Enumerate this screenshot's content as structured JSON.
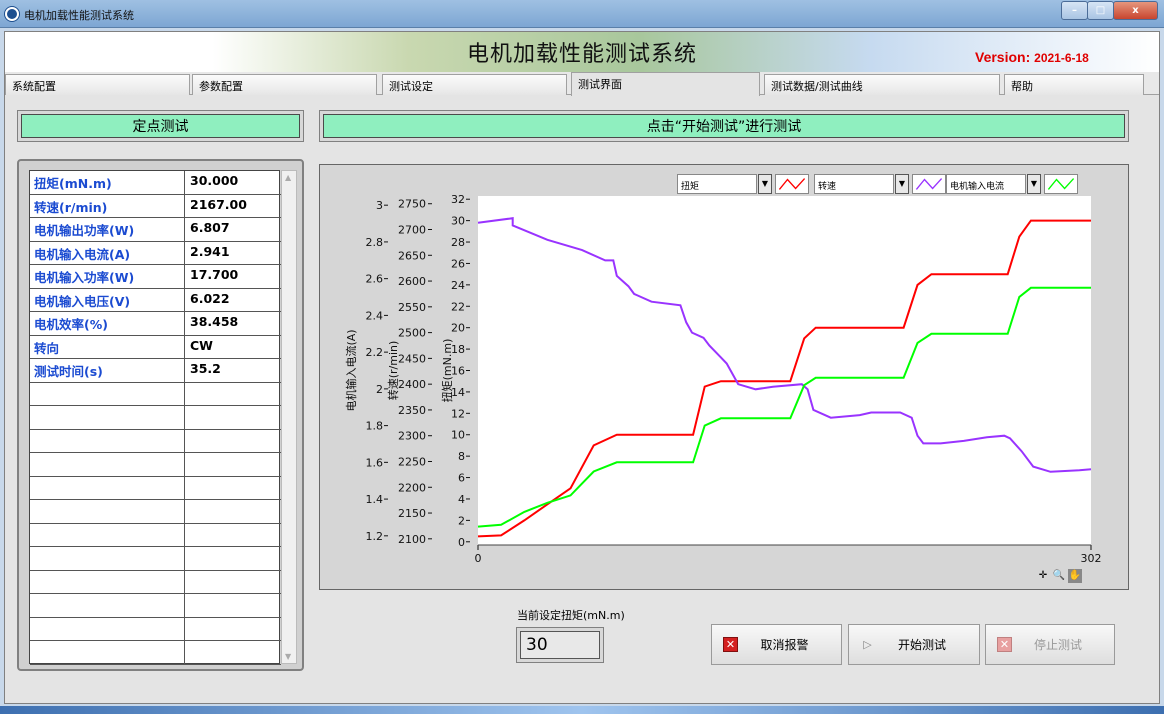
{
  "window": {
    "title": "电机加载性能测试系统",
    "min": "–",
    "max": "□",
    "close": "x"
  },
  "banner": {
    "title": "电机加载性能测试系统",
    "version_prefix": "Version: ",
    "version_date": "2021-6-18"
  },
  "tabs": [
    {
      "label": "系统配置"
    },
    {
      "label": "参数配置"
    },
    {
      "label": "测试设定"
    },
    {
      "label": "测试界面",
      "active": true
    },
    {
      "label": "测试数据/测试曲线"
    },
    {
      "label": "帮助"
    }
  ],
  "left_panel": {
    "title": "定点测试"
  },
  "right_panel": {
    "title": "点击“开始测试”进行测试"
  },
  "table": {
    "rows": [
      {
        "name": "扭矩(mN.m)",
        "value": "30.000"
      },
      {
        "name": "转速(r/min)",
        "value": "2167.00"
      },
      {
        "name": "电机输出功率(W)",
        "value": "6.807"
      },
      {
        "name": "电机输入电流(A)",
        "value": "2.941"
      },
      {
        "name": "电机输入功率(W)",
        "value": "17.700"
      },
      {
        "name": "电机输入电压(V)",
        "value": "6.022"
      },
      {
        "name": "电机效率(%)",
        "value": "38.458"
      },
      {
        "name": "转向",
        "value": "CW"
      },
      {
        "name": "测试时间(s)",
        "value": "35.2"
      }
    ],
    "empty_rows": 12
  },
  "legend": [
    {
      "label": "扭矩",
      "color": "#ff0000"
    },
    {
      "label": "转速",
      "color": "#9933ff"
    },
    {
      "label": "电机输入电流",
      "color": "#00ff00"
    }
  ],
  "chart_data": {
    "type": "line",
    "x_range": [
      0,
      302
    ],
    "x_ticks": [
      "0",
      "302"
    ],
    "axes": [
      {
        "label": "电机输入电流(A)",
        "range": [
          1.15,
          3.05
        ],
        "ticks": [
          "1.2",
          "1.4",
          "1.6",
          "1.8",
          "2",
          "2.2",
          "2.4",
          "2.6",
          "2.8",
          "3"
        ]
      },
      {
        "label": "转速(r/min)",
        "range": [
          2088,
          2765
        ],
        "ticks": [
          "2100",
          "2150",
          "2200",
          "2250",
          "2300",
          "2350",
          "2400",
          "2450",
          "2500",
          "2550",
          "2600",
          "2650",
          "2700",
          "2750"
        ]
      },
      {
        "label": "扭矩(mN.m)",
        "range": [
          -0.3,
          32.3
        ],
        "ticks": [
          "0",
          "2",
          "4",
          "6",
          "8",
          "10",
          "12",
          "14",
          "16",
          "18",
          "20",
          "22",
          "24",
          "26",
          "28",
          "30",
          "32"
        ]
      }
    ],
    "series": [
      {
        "name": "扭矩",
        "axis": 2,
        "color": "#ff0000",
        "points": [
          [
            0,
            0.5
          ],
          [
            20,
            0.6
          ],
          [
            40,
            2
          ],
          [
            60,
            3.5
          ],
          [
            80,
            5
          ],
          [
            100,
            9
          ],
          [
            120,
            10
          ],
          [
            140,
            10
          ],
          [
            186,
            10
          ],
          [
            196,
            14.5
          ],
          [
            210,
            15
          ],
          [
            270,
            15
          ],
          [
            282,
            19
          ],
          [
            292,
            20
          ],
          [
            368,
            20
          ],
          [
            380,
            24
          ],
          [
            392,
            25
          ],
          [
            458,
            25
          ],
          [
            468,
            28.5
          ],
          [
            478,
            30
          ],
          [
            530,
            30
          ]
        ]
      },
      {
        "name": "转速",
        "axis": 1,
        "color": "#9933ff",
        "points": [
          [
            0,
            2713
          ],
          [
            30,
            2722
          ],
          [
            30,
            2708
          ],
          [
            60,
            2680
          ],
          [
            90,
            2660
          ],
          [
            110,
            2640
          ],
          [
            117,
            2640
          ],
          [
            120,
            2610
          ],
          [
            130,
            2590
          ],
          [
            135,
            2575
          ],
          [
            140,
            2570
          ],
          [
            150,
            2560
          ],
          [
            175,
            2553
          ],
          [
            180,
            2520
          ],
          [
            185,
            2500
          ],
          [
            195,
            2490
          ],
          [
            200,
            2475
          ],
          [
            210,
            2452
          ],
          [
            215,
            2440
          ],
          [
            225,
            2400
          ],
          [
            240,
            2390
          ],
          [
            255,
            2395
          ],
          [
            280,
            2400
          ],
          [
            285,
            2390
          ],
          [
            290,
            2350
          ],
          [
            305,
            2335
          ],
          [
            330,
            2340
          ],
          [
            340,
            2345
          ],
          [
            365,
            2345
          ],
          [
            375,
            2335
          ],
          [
            380,
            2300
          ],
          [
            385,
            2285
          ],
          [
            400,
            2285
          ],
          [
            420,
            2290
          ],
          [
            440,
            2297
          ],
          [
            455,
            2300
          ],
          [
            460,
            2295
          ],
          [
            470,
            2270
          ],
          [
            480,
            2240
          ],
          [
            495,
            2230
          ],
          [
            520,
            2233
          ],
          [
            530,
            2235
          ]
        ]
      },
      {
        "name": "电机输入电流",
        "axis": 0,
        "color": "#00ff00",
        "points": [
          [
            0,
            1.25
          ],
          [
            20,
            1.26
          ],
          [
            40,
            1.33
          ],
          [
            60,
            1.38
          ],
          [
            80,
            1.42
          ],
          [
            100,
            1.55
          ],
          [
            120,
            1.6
          ],
          [
            140,
            1.6
          ],
          [
            186,
            1.6
          ],
          [
            196,
            1.8
          ],
          [
            210,
            1.84
          ],
          [
            270,
            1.84
          ],
          [
            282,
            2.02
          ],
          [
            292,
            2.06
          ],
          [
            368,
            2.06
          ],
          [
            380,
            2.25
          ],
          [
            392,
            2.3
          ],
          [
            458,
            2.3
          ],
          [
            468,
            2.5
          ],
          [
            478,
            2.55
          ],
          [
            530,
            2.55
          ]
        ]
      }
    ]
  },
  "setpoint": {
    "label": "当前设定扭矩(mN.m)",
    "value": "30"
  },
  "buttons": [
    {
      "label": "取消报警"
    },
    {
      "label": "开始测试"
    },
    {
      "label": "停止测试"
    }
  ]
}
